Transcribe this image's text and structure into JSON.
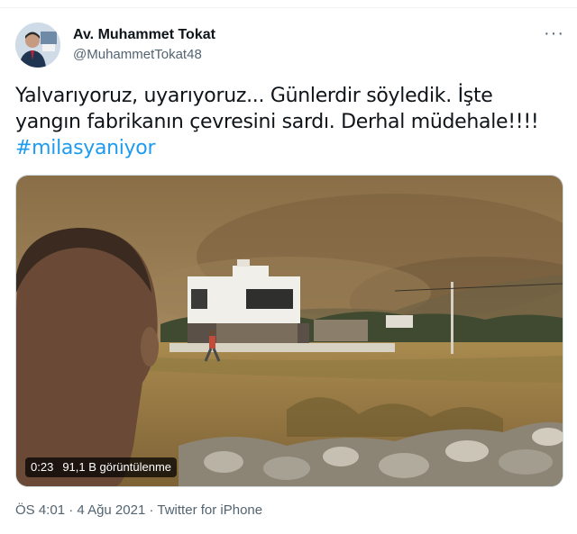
{
  "tweet": {
    "author_name": "Av. Muhammet Tokat",
    "author_handle": "@MuhammetTokat48",
    "text_line1": "Yalvarıyoruz, uyarıyoruz... Günlerdir söyledik. İşte",
    "text_line2": "yangın fabrikanın çevresini sardı. Derhal müdehale!!!!",
    "hashtag": "#milasyaniyor",
    "more_icon": "more-options-icon",
    "more_glyph": "···"
  },
  "video": {
    "duration": "0:23",
    "views": "91,1 B görüntülenme"
  },
  "meta": {
    "time": "ÖS 4:01",
    "sep1": "·",
    "date": "4 Ağu 2021",
    "sep2": "·",
    "source": "Twitter for iPhone"
  },
  "colors": {
    "accent": "#1d9bf0",
    "secondary_text": "#536471",
    "primary_text": "#0f1419"
  }
}
